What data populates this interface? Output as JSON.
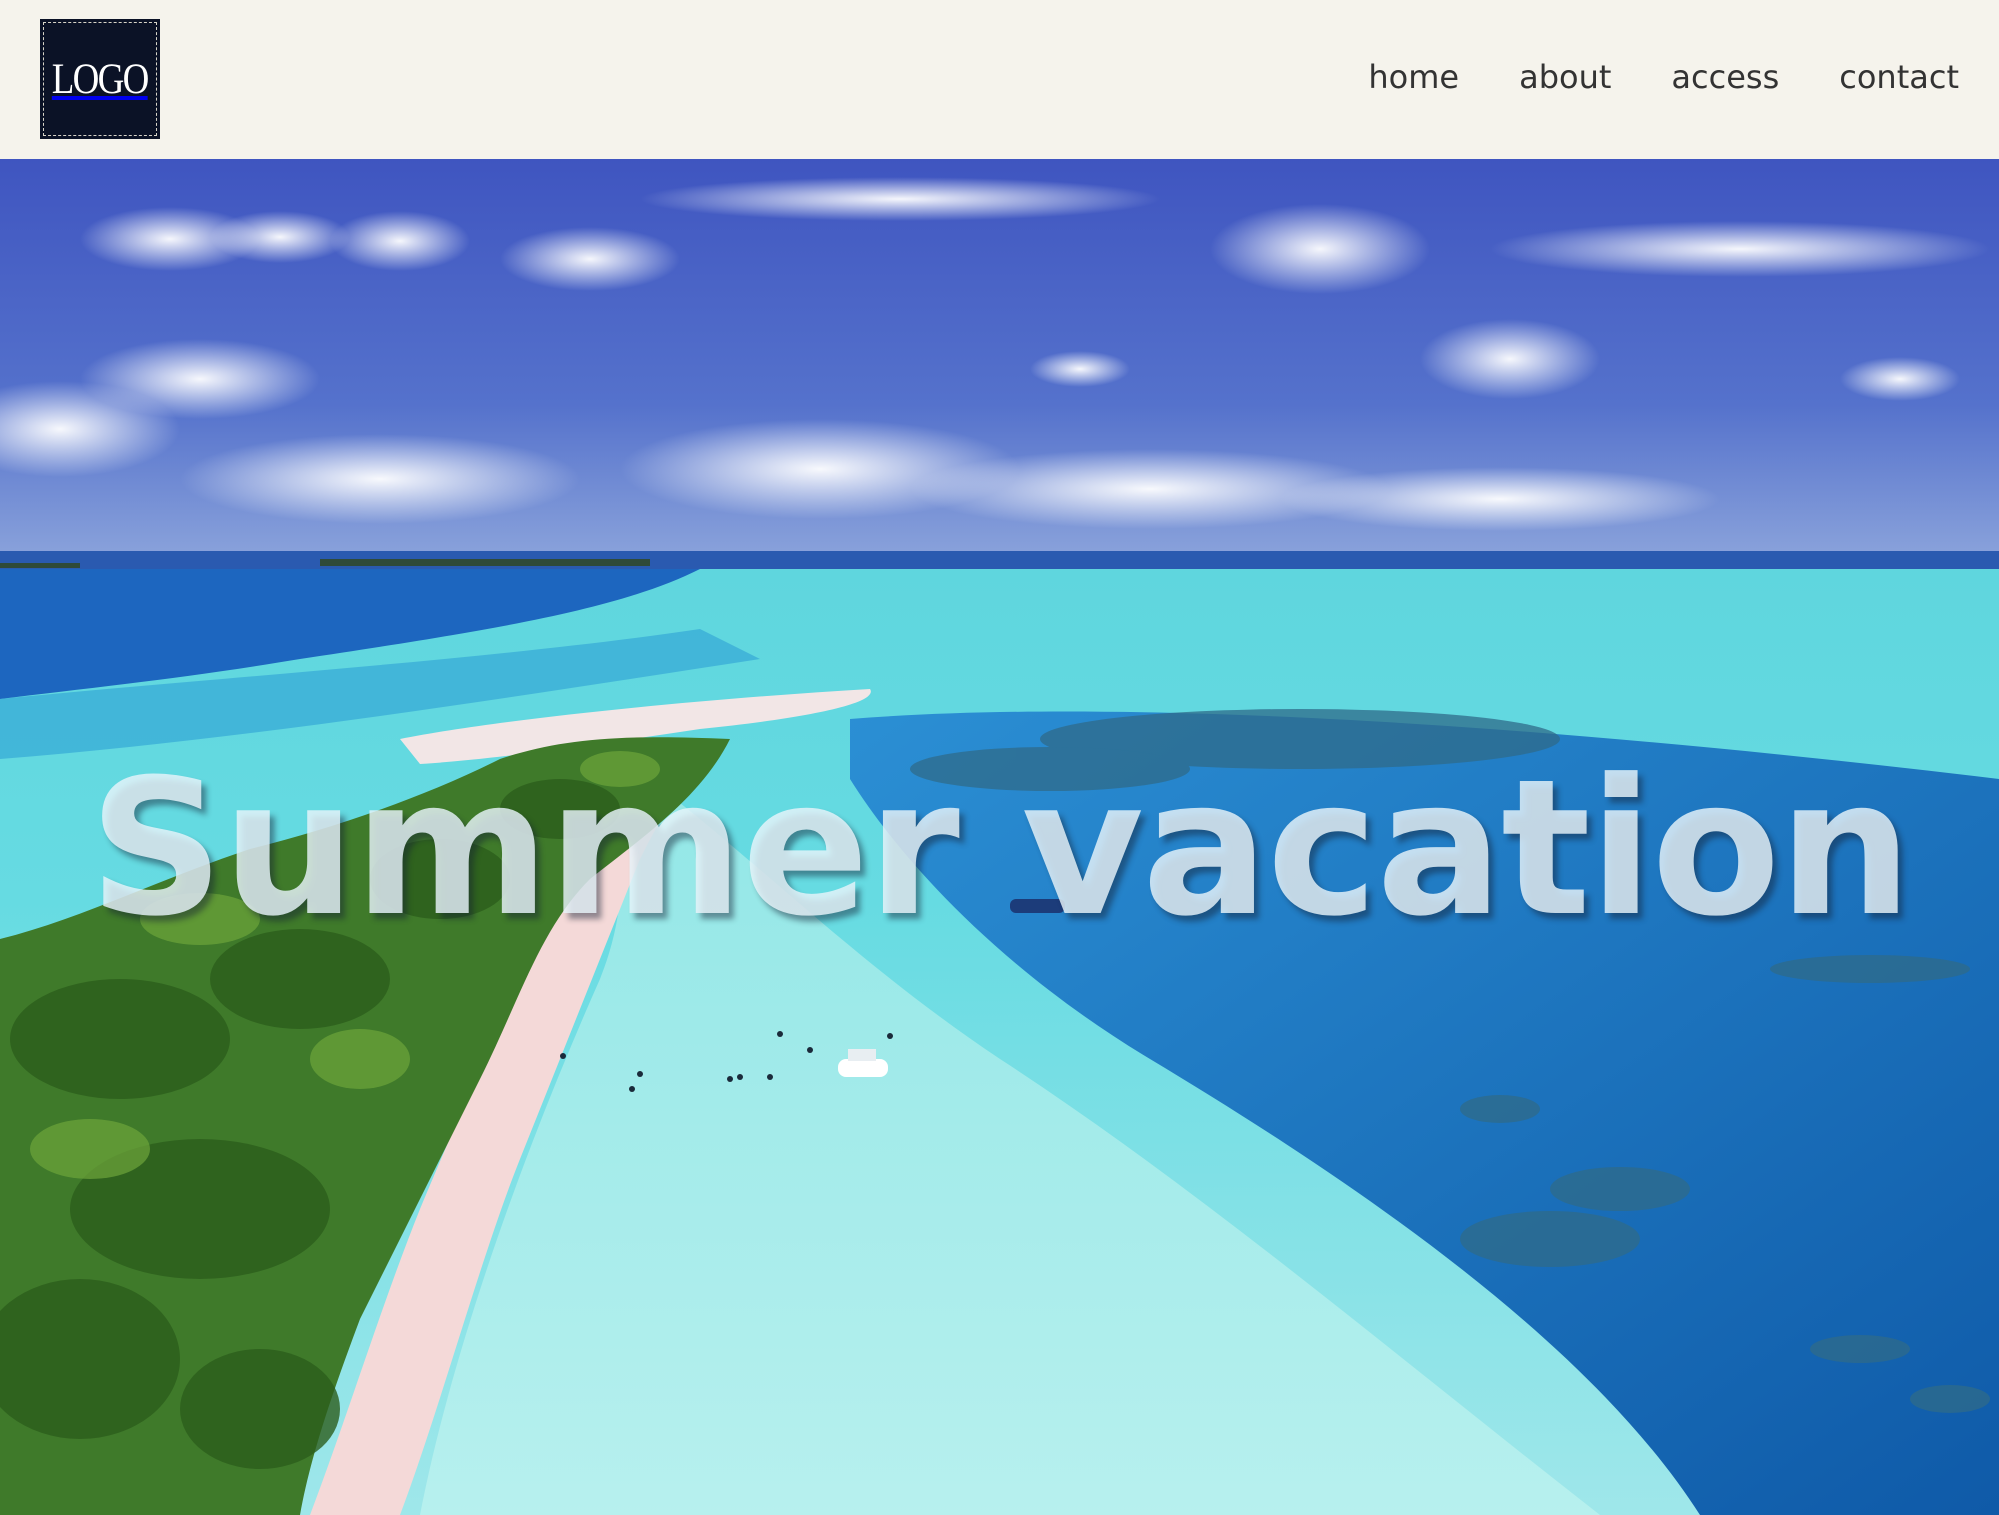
{
  "header": {
    "logo_text": "LOGO",
    "nav": [
      {
        "label": "home"
      },
      {
        "label": "about"
      },
      {
        "label": "access"
      },
      {
        "label": "contact"
      }
    ]
  },
  "hero": {
    "title": "Summer vacation",
    "image_description_icon": "tropical-island-photo"
  },
  "colors": {
    "header_bg": "#f5f3ec",
    "logo_bg": "#0b1226",
    "nav_text": "#333333",
    "sky": "#4a64c4",
    "lagoon": "#56d3dc",
    "deep_sea": "#1a6cc0"
  }
}
